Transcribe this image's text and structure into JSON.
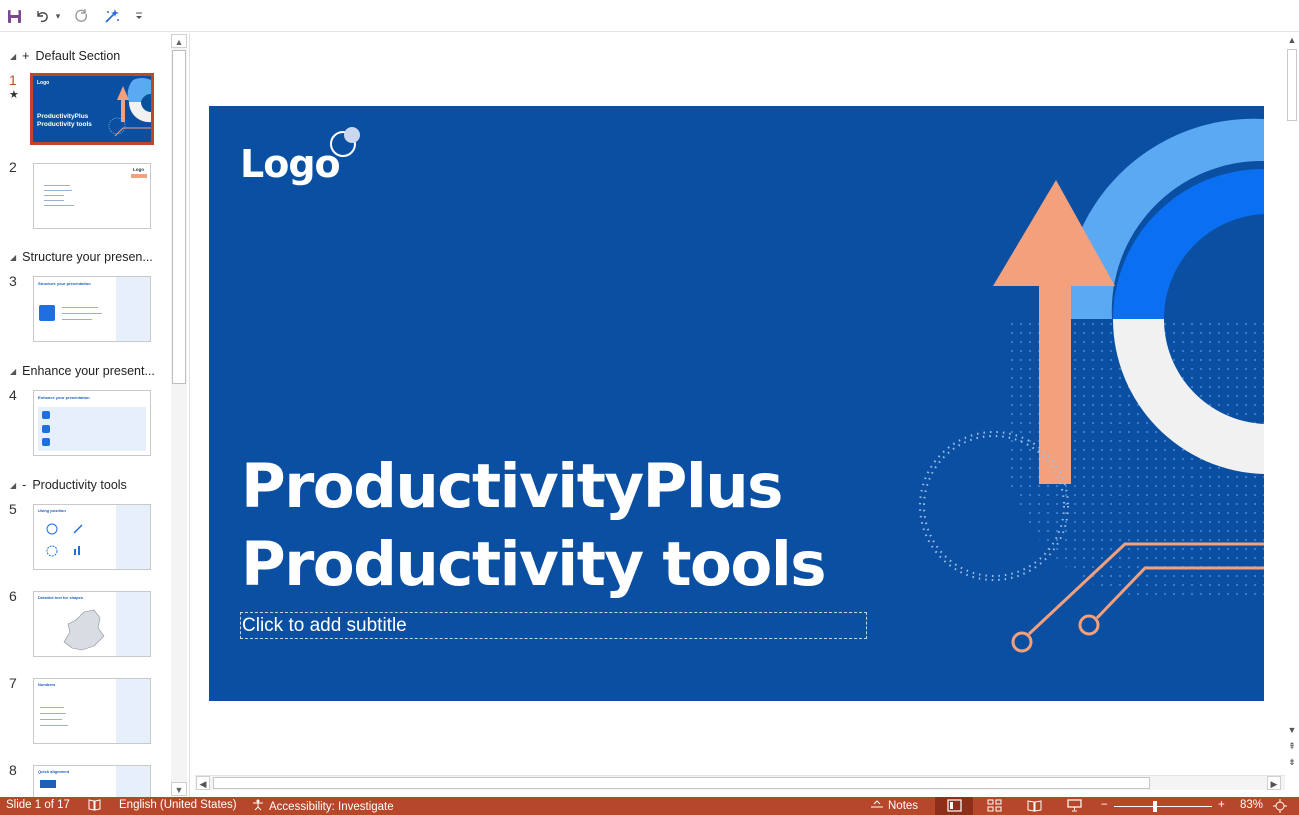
{
  "toolbar": {
    "save": "save-icon",
    "undo": "undo-icon",
    "undo_dropdown": "chevron-down-icon",
    "redo": "redo-icon",
    "designer": "magic-wand-icon",
    "customize": "customize-qat-icon"
  },
  "sections": [
    {
      "label": "Default Section",
      "prefix": "+"
    },
    {
      "label": "Structure your presen...",
      "prefix": ""
    },
    {
      "label": "Enhance your present...",
      "prefix": ""
    },
    {
      "label": "Productivity tools",
      "prefix": "-"
    }
  ],
  "slide_numbers": [
    "1",
    "2",
    "3",
    "4",
    "5",
    "6",
    "7",
    "8"
  ],
  "slide1_marker": "★",
  "thumbnails": {
    "s1_title": "ProductivityPlus Productivity tools",
    "s1_logo": "Logo",
    "s3_title": "Structure your presentation",
    "s4_title": "Enhance your presentation",
    "s5_title": "Using position",
    "s6_title": "Detailed text for shapes",
    "s7_title": "Numbers",
    "s8_title": "Quick alignment",
    "logo": "Logo"
  },
  "slide": {
    "logo": "Logo",
    "title_line1": "ProductivityPlus",
    "title_line2": "Productivity tools",
    "subtitle_placeholder": "Click to add subtitle"
  },
  "colors": {
    "slide_bg": "#0a4fa1",
    "accent_orange": "#f4a07c",
    "light_blue": "#5aa9f2",
    "bright_blue": "#0a6ff0",
    "statusbar": "#b7472a",
    "selection": "#c0452c"
  },
  "status": {
    "slide_counter": "Slide 1 of 17",
    "language": "English (United States)",
    "accessibility": "Accessibility: Investigate",
    "notes": "Notes",
    "zoom": "83%",
    "zoom_minus": "−",
    "zoom_plus": "+"
  }
}
